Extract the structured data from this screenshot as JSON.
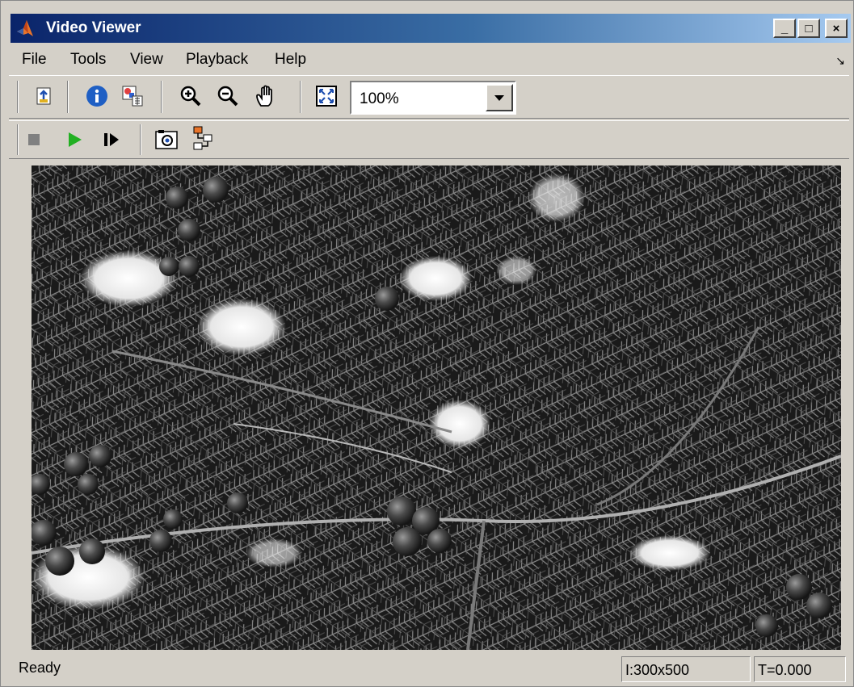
{
  "window": {
    "title": "Video Viewer"
  },
  "title_buttons": {
    "minimize": "_",
    "maximize": "□",
    "close": "×"
  },
  "menu": {
    "items": [
      "File",
      "Tools",
      "View",
      "Playback",
      "Help"
    ]
  },
  "toolbar1": {
    "icons": [
      "open-file-icon",
      "info-icon",
      "image-properties-icon",
      "zoom-in-icon",
      "zoom-out-icon",
      "pan-hand-icon",
      "fit-to-window-icon"
    ],
    "zoom": {
      "value": "100%"
    }
  },
  "toolbar2": {
    "icons": [
      "stop-icon",
      "play-icon",
      "step-forward-icon",
      "snapshot-icon",
      "simulink-signal-icon"
    ],
    "colors": {
      "play": "#22b022",
      "stop": "#808080"
    }
  },
  "viewer": {
    "image": "grayscale-evergreen-berries-snow-frame"
  },
  "status": {
    "text": "Ready",
    "image_size": "I:300x500",
    "time": "T=0.000"
  }
}
